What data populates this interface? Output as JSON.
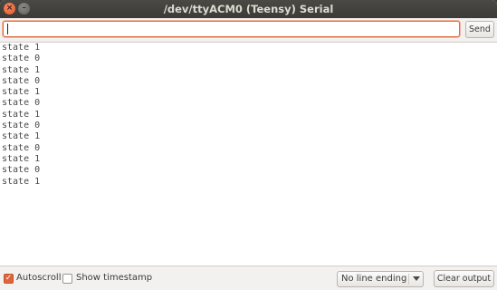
{
  "window": {
    "title": "/dev/ttyACM0 (Teensy) Serial",
    "close_glyph": "×",
    "minimize_glyph": "–"
  },
  "input": {
    "value": "",
    "send_label": "Send"
  },
  "output": {
    "lines": [
      "state 1",
      "state 0",
      "state 1",
      "state 0",
      "state 1",
      "state 0",
      "state 1",
      "state 0",
      "state 1",
      "state 0",
      "state 1",
      "state 0",
      "state 1"
    ]
  },
  "footer": {
    "autoscroll_label": "Autoscroll",
    "autoscroll_checked": true,
    "autoscroll_check_glyph": "✓",
    "timestamp_label": "Show timestamp",
    "timestamp_checked": false,
    "line_ending_selected": "No line ending",
    "clear_label": "Clear output"
  },
  "colors": {
    "accent": "#e0643a",
    "titlebar": "#3c3b37"
  }
}
